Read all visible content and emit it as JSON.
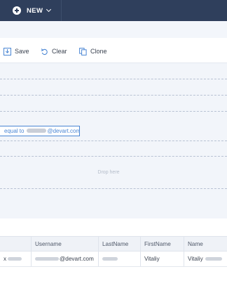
{
  "topbar": {
    "new_label": "NEW"
  },
  "toolbar": {
    "save_label": "Save",
    "clear_label": "Clear",
    "clone_label": "Clone"
  },
  "filter": {
    "condition_prefix": "equal to",
    "condition_value": "@devart.com"
  },
  "drop_zone": {
    "label": "Drop here"
  },
  "more_indicator": "...",
  "grid": {
    "columns": [
      "",
      "Username",
      "LastName",
      "FirstName",
      "Name"
    ],
    "rows": [
      {
        "id_prefix": "x",
        "username": "@devart.com",
        "lastname": "",
        "firstname": "Vitaliy",
        "name": "Vitaliy"
      }
    ]
  },
  "colors": {
    "topbar": "#2f3f5c",
    "accent": "#4a86d4",
    "panel": "#f2f5fa"
  }
}
